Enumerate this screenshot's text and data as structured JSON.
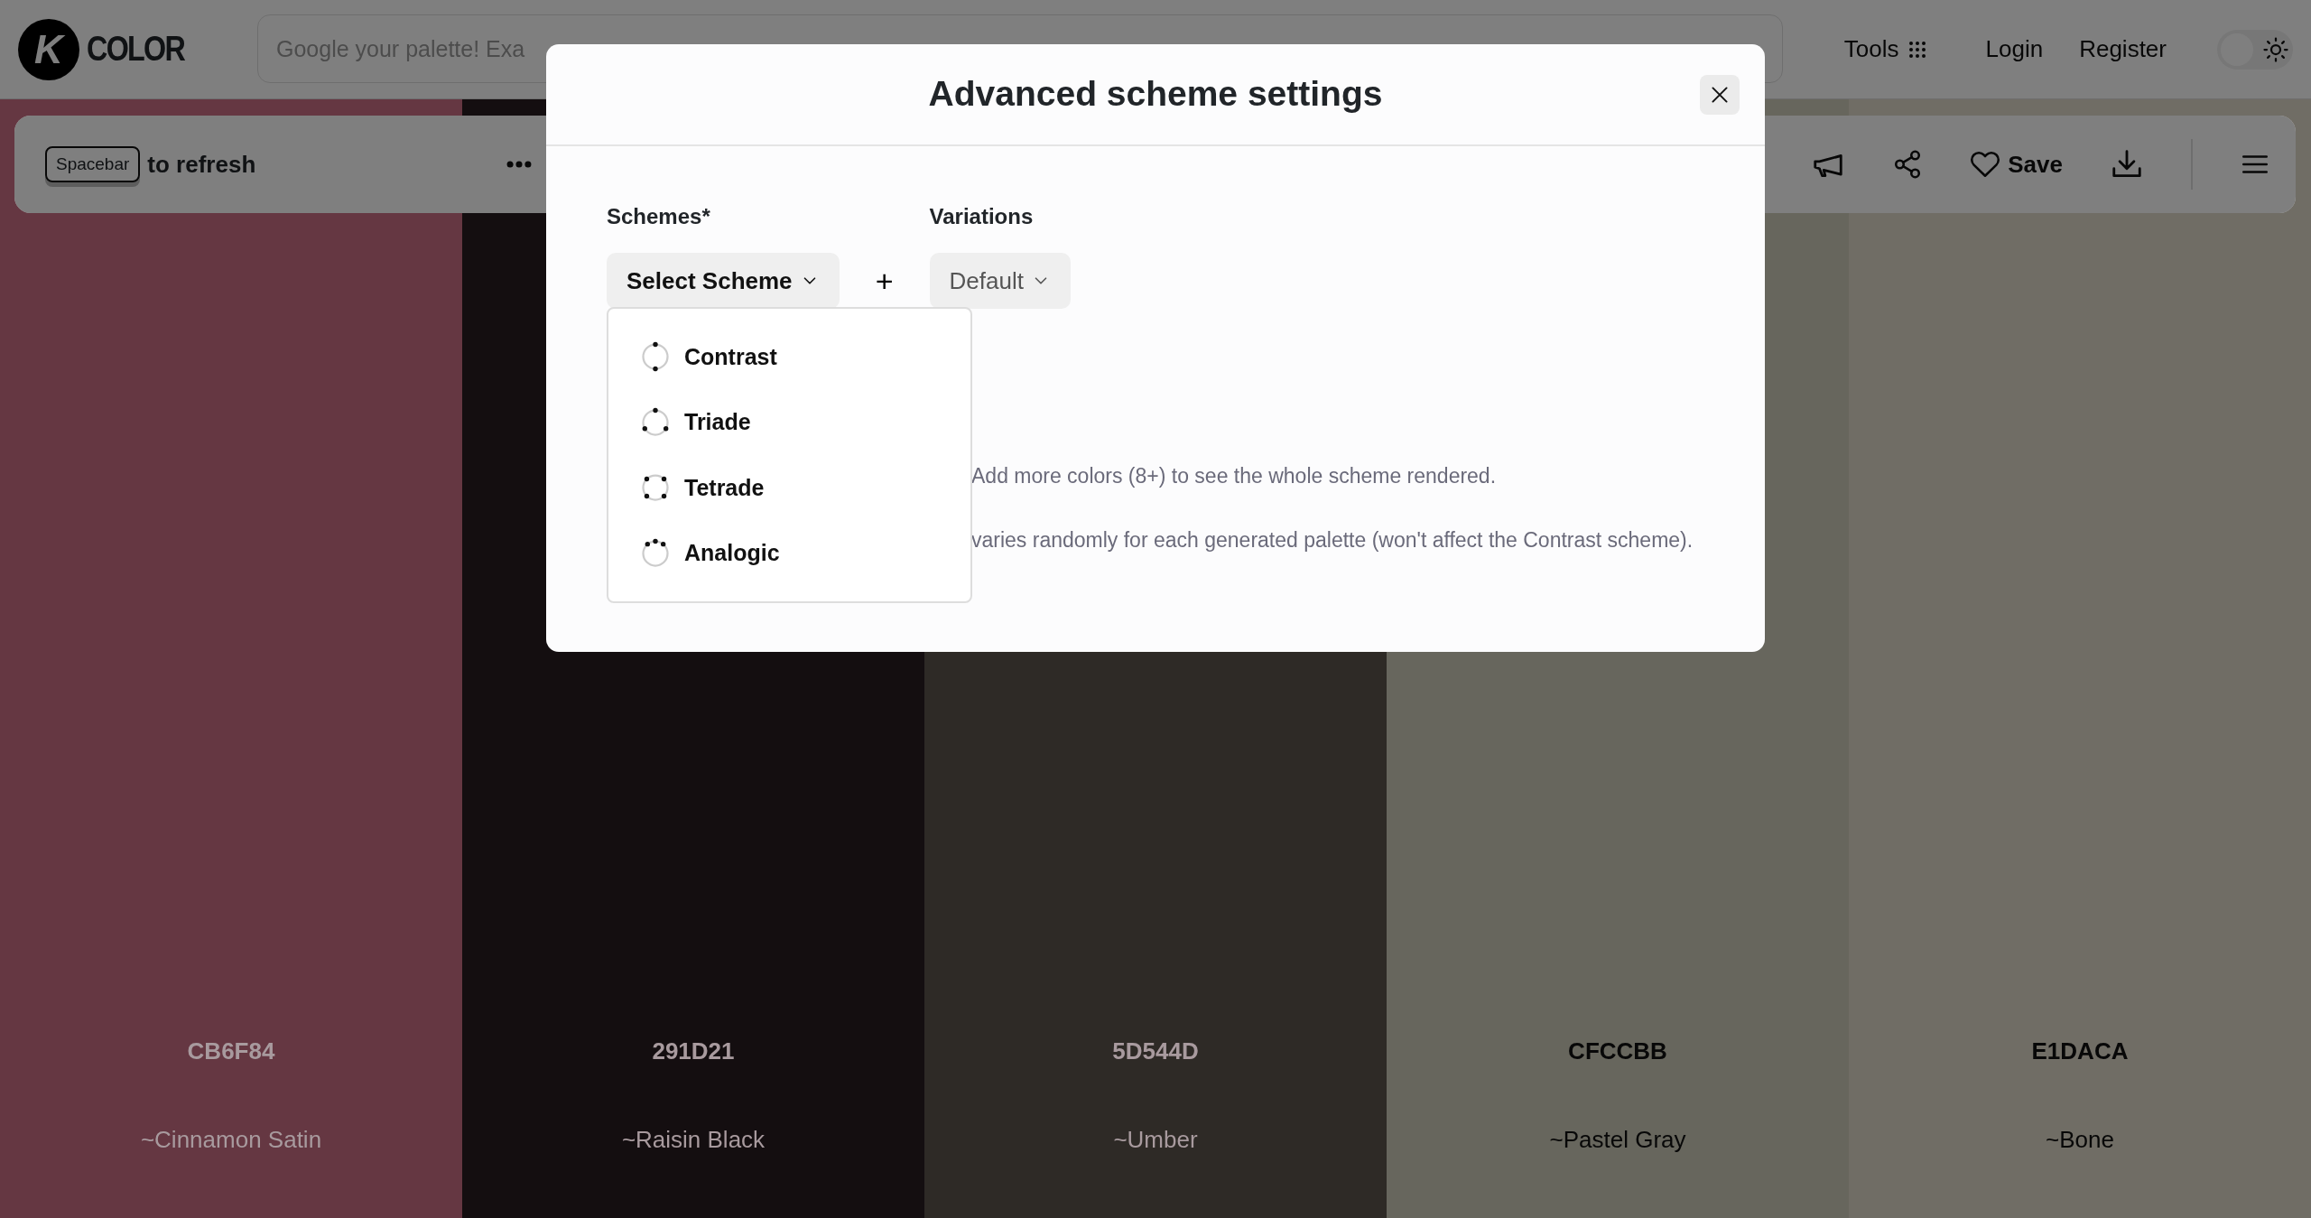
{
  "header": {
    "logo_mark": "K",
    "logo": "COLOR",
    "search": {
      "placeholder": "Google your palette! Exa"
    },
    "nav": [
      {
        "label": "Tools",
        "kind": "tools"
      },
      {
        "label": "Login",
        "kind": "link"
      },
      {
        "label": "Register",
        "kind": "link"
      }
    ],
    "theme_toggle": {
      "on": false
    }
  },
  "toolbar": {
    "key": "Spacebar",
    "hint": "to refresh",
    "save": "Save"
  },
  "swatches": [
    {
      "color": "#653742",
      "hex": "CB6F84",
      "name": "~Cinnamon Satin"
    },
    {
      "color": "#140e10",
      "hex": "291D21",
      "name": "~Raisin Black"
    },
    {
      "color": "#2e2a26",
      "hex": "5D544D",
      "name": "~Umber"
    },
    {
      "color": "#67665d",
      "hex": "CFCCBB",
      "name": "~Pastel Gray"
    },
    {
      "color": "#706d65",
      "hex": "E1DACA",
      "name": "~Bone"
    }
  ],
  "modal": {
    "title": "Advanced scheme settings",
    "schemes_label": "Schemes*",
    "scheme_button": "Select Scheme",
    "add": "+",
    "variations_label": "Variations",
    "variation_button": "Default",
    "menu": [
      {
        "label": "Contrast",
        "kind": "contrast"
      },
      {
        "label": "Triade",
        "kind": "triade"
      },
      {
        "label": "Tetrade",
        "kind": "tetrade"
      },
      {
        "label": "Analogic",
        "kind": "analogic"
      }
    ],
    "notes": [
      "Add more colors (8+) to see the whole scheme rendered.",
      "varies randomly for each generated palette (won't affect the Contrast scheme)."
    ]
  }
}
